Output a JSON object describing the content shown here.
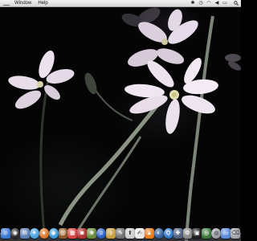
{
  "menubar": {
    "items": [
      {
        "label": "Window"
      },
      {
        "label": "Help"
      }
    ],
    "status_icons": [
      {
        "icon": "bluetooth-icon",
        "glyph": "✱"
      },
      {
        "icon": "clock-icon",
        "glyph": "◷"
      },
      {
        "icon": "wifi-icon",
        "glyph": "◠"
      },
      {
        "icon": "volume-icon",
        "glyph": "◀"
      },
      {
        "icon": "battery-icon",
        "glyph": "▭"
      }
    ],
    "clock_text": "",
    "search_icon": "spotlight-search-icon"
  },
  "dock": {
    "apps": [
      {
        "name": "finder-icon",
        "color": "#3a78d8",
        "glyph": "☺",
        "round": false
      },
      {
        "name": "dashboard-icon",
        "color": "#2b2b2b",
        "glyph": "◉",
        "round": true
      },
      {
        "name": "mail-icon",
        "color": "#5b7fb5",
        "glyph": "✉",
        "round": false
      },
      {
        "name": "safari-icon",
        "color": "#4aa3e0",
        "glyph": "✦",
        "round": true
      },
      {
        "name": "firefox-icon",
        "color": "#e0782a",
        "glyph": "●",
        "round": true
      },
      {
        "name": "ichat-icon",
        "color": "#3a9ad9",
        "glyph": "◉",
        "round": true
      },
      {
        "name": "address-book-icon",
        "color": "#8a5a2b",
        "glyph": "@",
        "round": false
      },
      {
        "name": "calendar-icon",
        "color": "#d94141",
        "glyph": "▦",
        "round": false
      },
      {
        "name": "photo-booth-icon",
        "color": "#b03030",
        "glyph": "◙",
        "round": false
      },
      {
        "name": "iphoto-icon",
        "color": "#6a8a3a",
        "glyph": "❀",
        "round": false
      },
      {
        "name": "itunes-icon",
        "color": "#2a60c0",
        "glyph": "♫",
        "round": true
      },
      {
        "name": "garageband-icon",
        "color": "#c8a040",
        "glyph": "♪",
        "round": false
      },
      {
        "name": "utility-icon",
        "color": "#707070",
        "glyph": "✎",
        "round": false
      },
      {
        "name": "preview-icon",
        "color": "#cccccc",
        "glyph": "⬆",
        "round": false
      },
      {
        "name": "textedit-icon",
        "color": "#e8e8e8",
        "glyph": "✍",
        "round": false
      },
      {
        "name": "vlc-icon",
        "color": "#e87a1a",
        "glyph": "▲",
        "round": false
      },
      {
        "name": "camino-icon",
        "color": "#3060a0",
        "glyph": "◐",
        "round": true
      },
      {
        "name": "quicktime-icon",
        "color": "#2a7ad0",
        "glyph": "Q",
        "round": true
      },
      {
        "name": "app-store-icon",
        "color": "#506080",
        "glyph": "✚",
        "round": false
      },
      {
        "name": "system-preferences-icon",
        "color": "#8a8a8a",
        "glyph": "⚙",
        "round": false
      },
      {
        "name": "terminal-icon",
        "color": "#202020",
        "glyph": "▣",
        "round": false
      },
      {
        "name": "activity-monitor-icon",
        "color": "#3a7a3a",
        "glyph": "◎",
        "round": false
      },
      {
        "name": "disk-utility-icon",
        "color": "#9aa0a8",
        "glyph": "◍",
        "round": true
      },
      {
        "name": "folder-icon",
        "color": "#5a8ad8",
        "glyph": "▭",
        "round": false
      },
      {
        "name": "trash-icon",
        "color": "#a0a4aa",
        "glyph": "⌫",
        "round": false
      }
    ]
  },
  "wallpaper": {
    "subject": "white-star-flowers",
    "petal_color": "#f1e6f2",
    "center_color": "#e8e2b0",
    "stem_color": "#6f7a6a"
  }
}
